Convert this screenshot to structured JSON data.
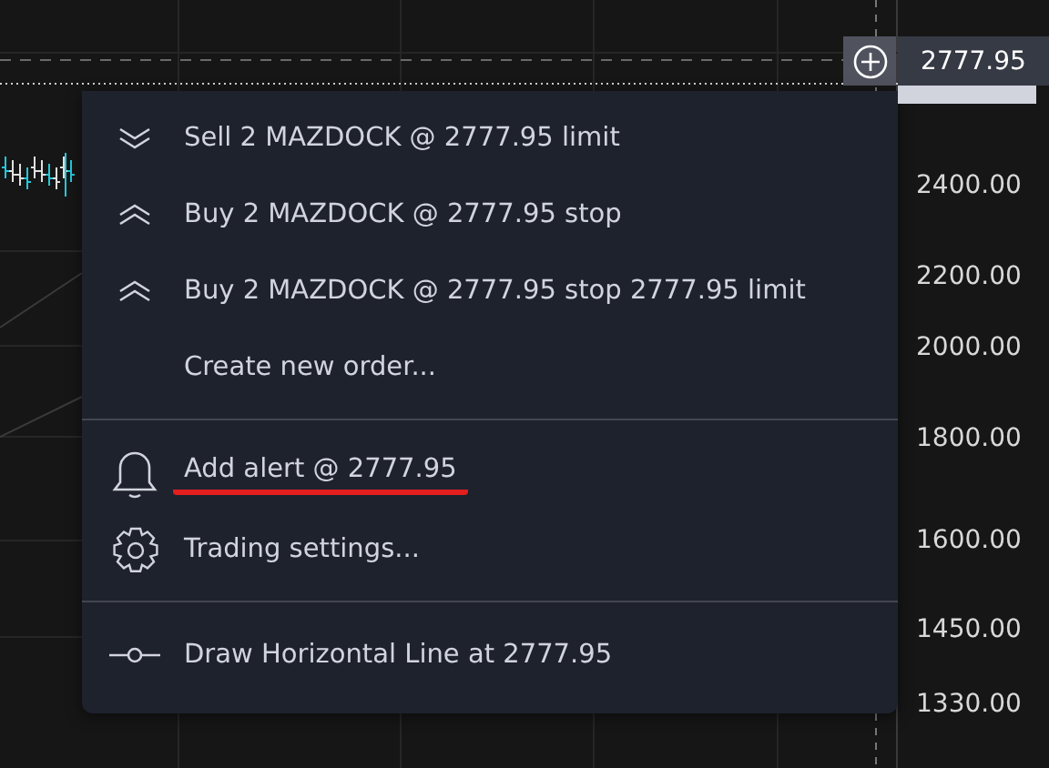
{
  "price_axis": {
    "current_price": "2777.95",
    "labels": [
      "2400.00",
      "2200.00",
      "2000.00",
      "1800.00",
      "1600.00",
      "1450.00",
      "1330.00"
    ]
  },
  "menu": {
    "sections": [
      [
        {
          "kind": "sell",
          "label": "Sell 2 MAZDOCK @ 2777.95 limit",
          "underlined": false
        },
        {
          "kind": "buy",
          "label": "Buy 2 MAZDOCK @ 2777.95 stop",
          "underlined": false
        },
        {
          "kind": "buy",
          "label": "Buy 2 MAZDOCK @ 2777.95 stop 2777.95 limit",
          "underlined": false
        },
        {
          "kind": "plain",
          "label": "Create new order...",
          "underlined": false
        }
      ],
      [
        {
          "kind": "alert",
          "label": "Add alert @ 2777.95",
          "underlined": true
        },
        {
          "kind": "settings",
          "label": "Trading settings...",
          "underlined": false
        }
      ],
      [
        {
          "kind": "hline",
          "label": "Draw Horizontal Line at 2777.95",
          "underlined": false
        }
      ]
    ]
  }
}
